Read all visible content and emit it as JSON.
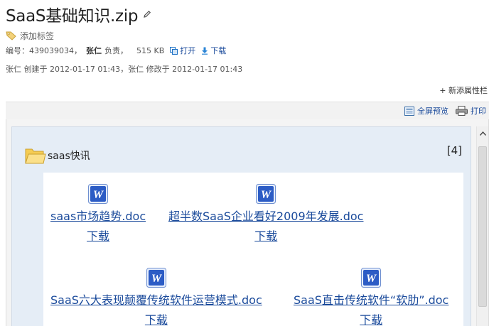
{
  "header": {
    "title": "SaaS基础知识.zip",
    "add_tag": "添加标签"
  },
  "meta": {
    "id_label": "编号：",
    "id_value": "439039034，",
    "owner": "张仁",
    "owner_role": "负责，",
    "size": "515 KB",
    "open_label": "打开",
    "download_label": "下载"
  },
  "audit": {
    "text": "张仁 创建于 2012-01-17 01:43，张仁 修改于 2012-01-17 01:43"
  },
  "add_attribute": "+ 新添属性栏",
  "toolbar": {
    "fullscreen_label": "全屏预览",
    "print_label": "打印"
  },
  "folder": {
    "name": "saas快讯",
    "count": "[4]",
    "files": [
      {
        "name": "saas市场趋势.doc",
        "download": "下载"
      },
      {
        "name": "超半数SaaS企业看好2009年发展.doc",
        "download": "下载"
      },
      {
        "name": "SaaS六大表现颠覆传统软件运营模式.doc",
        "download": "下载"
      },
      {
        "name": "SaaS直击传统软件“软肋”.doc",
        "download": "下载"
      }
    ]
  },
  "icons": {
    "edit": "pencil-icon",
    "tag": "tag-icon",
    "open": "open-icon",
    "download": "download-arrow-icon",
    "fullscreen": "fullscreen-icon",
    "print": "printer-icon",
    "folder": "folder-icon",
    "doc": "word-doc-icon"
  },
  "colors": {
    "link": "#1a4a9b",
    "panel": "#e5edf6",
    "toolbar": "#f2f2f2"
  }
}
